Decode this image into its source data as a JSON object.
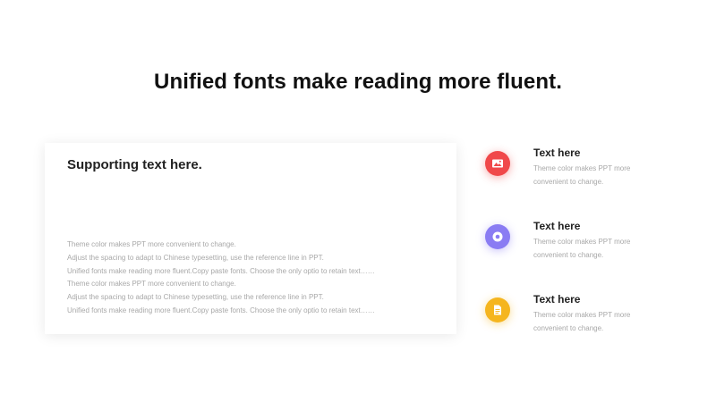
{
  "slide": {
    "title": "Unified fonts make reading more fluent."
  },
  "card": {
    "heading": "Supporting text here.",
    "lines": [
      "Theme  color makes PPT more convenient to change.",
      "Adjust the spacing to adapt to Chinese typesetting, use the reference line in PPT.",
      "Unified fonts make reading more fluent.Copy paste fonts. Choose the only optio to retain text……",
      "Theme  color makes PPT more convenient to change.",
      "Adjust the spacing to adapt to Chinese typesetting, use the reference line in PPT.",
      "Unified fonts make reading more fluent.Copy paste fonts. Choose the only optio to retain text……"
    ]
  },
  "items": [
    {
      "title": "Text here",
      "desc_line1": "Theme  color makes PPT more",
      "desc_line2": "convenient to change.",
      "icon": "image-icon",
      "color": "#f0484a"
    },
    {
      "title": "Text here",
      "desc_line1": "Theme  color makes PPT more",
      "desc_line2": "convenient to change.",
      "icon": "target-icon",
      "color": "#8a7cf3"
    },
    {
      "title": "Text here",
      "desc_line1": "Theme  color makes PPT more",
      "desc_line2": "convenient to change.",
      "icon": "document-icon",
      "color": "#f5b51e"
    }
  ]
}
